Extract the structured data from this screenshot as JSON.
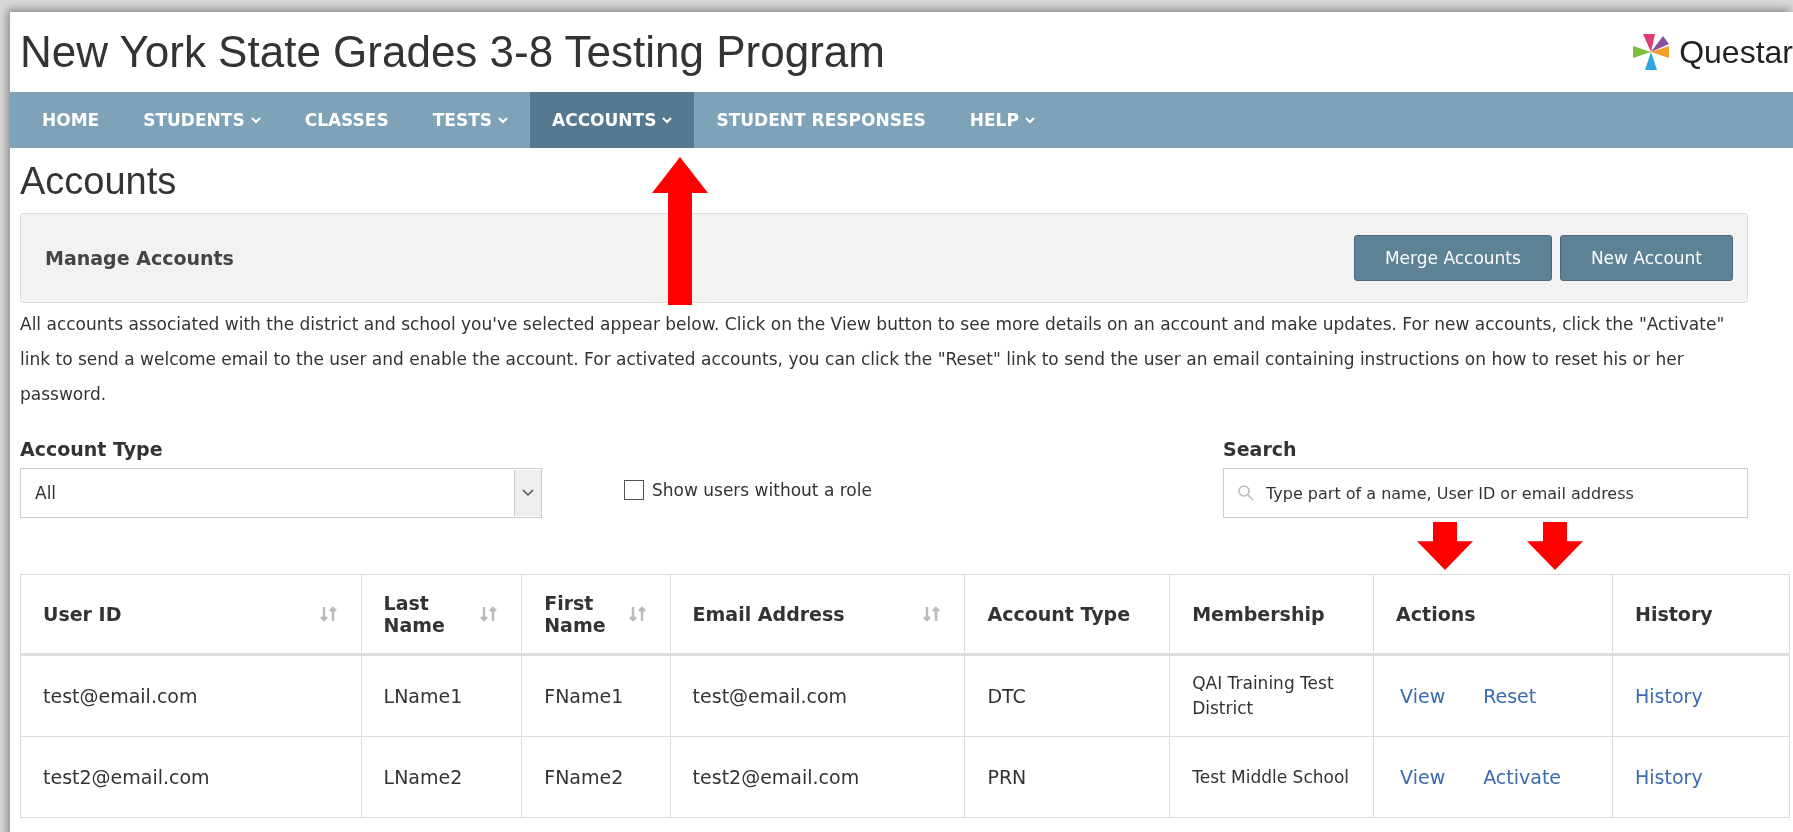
{
  "header": {
    "title": "New York State Grades 3-8 Testing Program",
    "logo": "Questar"
  },
  "nav": [
    {
      "label": "HOME",
      "dropdown": false,
      "selected": false
    },
    {
      "label": "STUDENTS",
      "dropdown": true,
      "selected": false
    },
    {
      "label": "CLASSES",
      "dropdown": false,
      "selected": false
    },
    {
      "label": "TESTS",
      "dropdown": true,
      "selected": false
    },
    {
      "label": "ACCOUNTS",
      "dropdown": true,
      "selected": true
    },
    {
      "label": "STUDENT RESPONSES",
      "dropdown": false,
      "selected": false
    },
    {
      "label": "HELP",
      "dropdown": true,
      "selected": false
    }
  ],
  "page_title": "Accounts",
  "panel": {
    "title": "Manage Accounts",
    "buttons": [
      "Merge Accounts",
      "New Account"
    ]
  },
  "description": "All accounts associated with the district and school you've selected appear below. Click on the View button to see more details on an account and make updates. For new accounts, click the \"Activate\" link to send a welcome email to the user and enable the account. For activated accounts, you can click the \"Reset\" link to send the user an email containing instructions on how to reset his or her password.",
  "filters": {
    "account_type": {
      "label": "Account Type",
      "value": "All"
    },
    "show_without_role": {
      "label": "Show users without a role",
      "checked": false
    },
    "search": {
      "label": "Search",
      "placeholder": "Type part of a name, User ID or email address"
    }
  },
  "table": {
    "columns": [
      {
        "label": "User ID",
        "sortable": true
      },
      {
        "label": "Last Name",
        "sortable": true
      },
      {
        "label": "First Name",
        "sortable": true
      },
      {
        "label": "Email Address",
        "sortable": true
      },
      {
        "label": "Account Type",
        "sortable": false
      },
      {
        "label": "Membership",
        "sortable": false
      },
      {
        "label": "Actions",
        "sortable": false
      },
      {
        "label": "History",
        "sortable": false
      }
    ],
    "rows": [
      {
        "user_id": "test@email.com",
        "last_name": "LName1",
        "first_name": "FName1",
        "email": "test@email.com",
        "account_type": "DTC",
        "membership": "QAI Training Test District",
        "actions": [
          "View",
          "Reset"
        ],
        "history": "History"
      },
      {
        "user_id": "test2@email.com",
        "last_name": "LName2",
        "first_name": "FName2",
        "email": "test2@email.com",
        "account_type": "PRN",
        "membership": "Test Middle School",
        "actions": [
          "View",
          "Activate"
        ],
        "history": "History"
      }
    ]
  },
  "annotation_arrows": [
    {
      "kind": "up"
    },
    {
      "kind": "down"
    },
    {
      "kind": "down"
    }
  ]
}
